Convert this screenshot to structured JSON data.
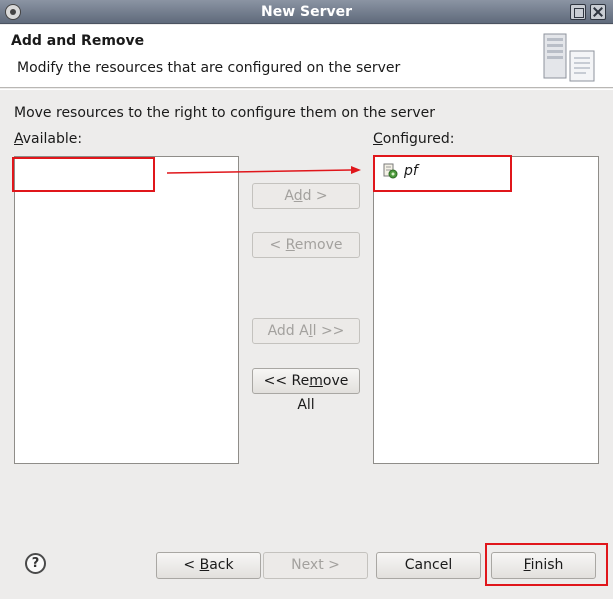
{
  "window": {
    "title": "New Server"
  },
  "header": {
    "title": "Add and Remove",
    "description": "Modify the resources that are configured on the server",
    "icon": "server-icon"
  },
  "main": {
    "instruction": "Move resources to the right to configure them on the server",
    "available_label": {
      "mnemonic": "A",
      "rest": "vailable:"
    },
    "configured_label": {
      "mnemonic": "C",
      "rest": "onfigured:"
    },
    "available_items": [],
    "configured_items": [
      {
        "label": "pf",
        "icon": "web-module-icon"
      }
    ]
  },
  "transfer_buttons": {
    "add": {
      "pre": "A",
      "mnemonic": "d",
      "post": "d >",
      "enabled": false
    },
    "remove": {
      "pre": "< ",
      "mnemonic": "R",
      "post": "emove",
      "enabled": false
    },
    "add_all": {
      "pre": "Add A",
      "mnemonic": "l",
      "post": "l >>",
      "enabled": false
    },
    "remove_all": {
      "pre": "<< Re",
      "mnemonic": "m",
      "post": "ove All",
      "enabled": true
    }
  },
  "footer": {
    "help_icon": "help-icon",
    "back": {
      "pre": "< ",
      "mnemonic": "B",
      "post": "ack",
      "enabled": true
    },
    "next": {
      "label": "Next >",
      "enabled": false
    },
    "cancel": {
      "label": "Cancel",
      "enabled": true
    },
    "finish": {
      "mnemonic": "F",
      "post": "inish",
      "enabled": true
    }
  },
  "annotations": {
    "color": "#e0161b"
  }
}
